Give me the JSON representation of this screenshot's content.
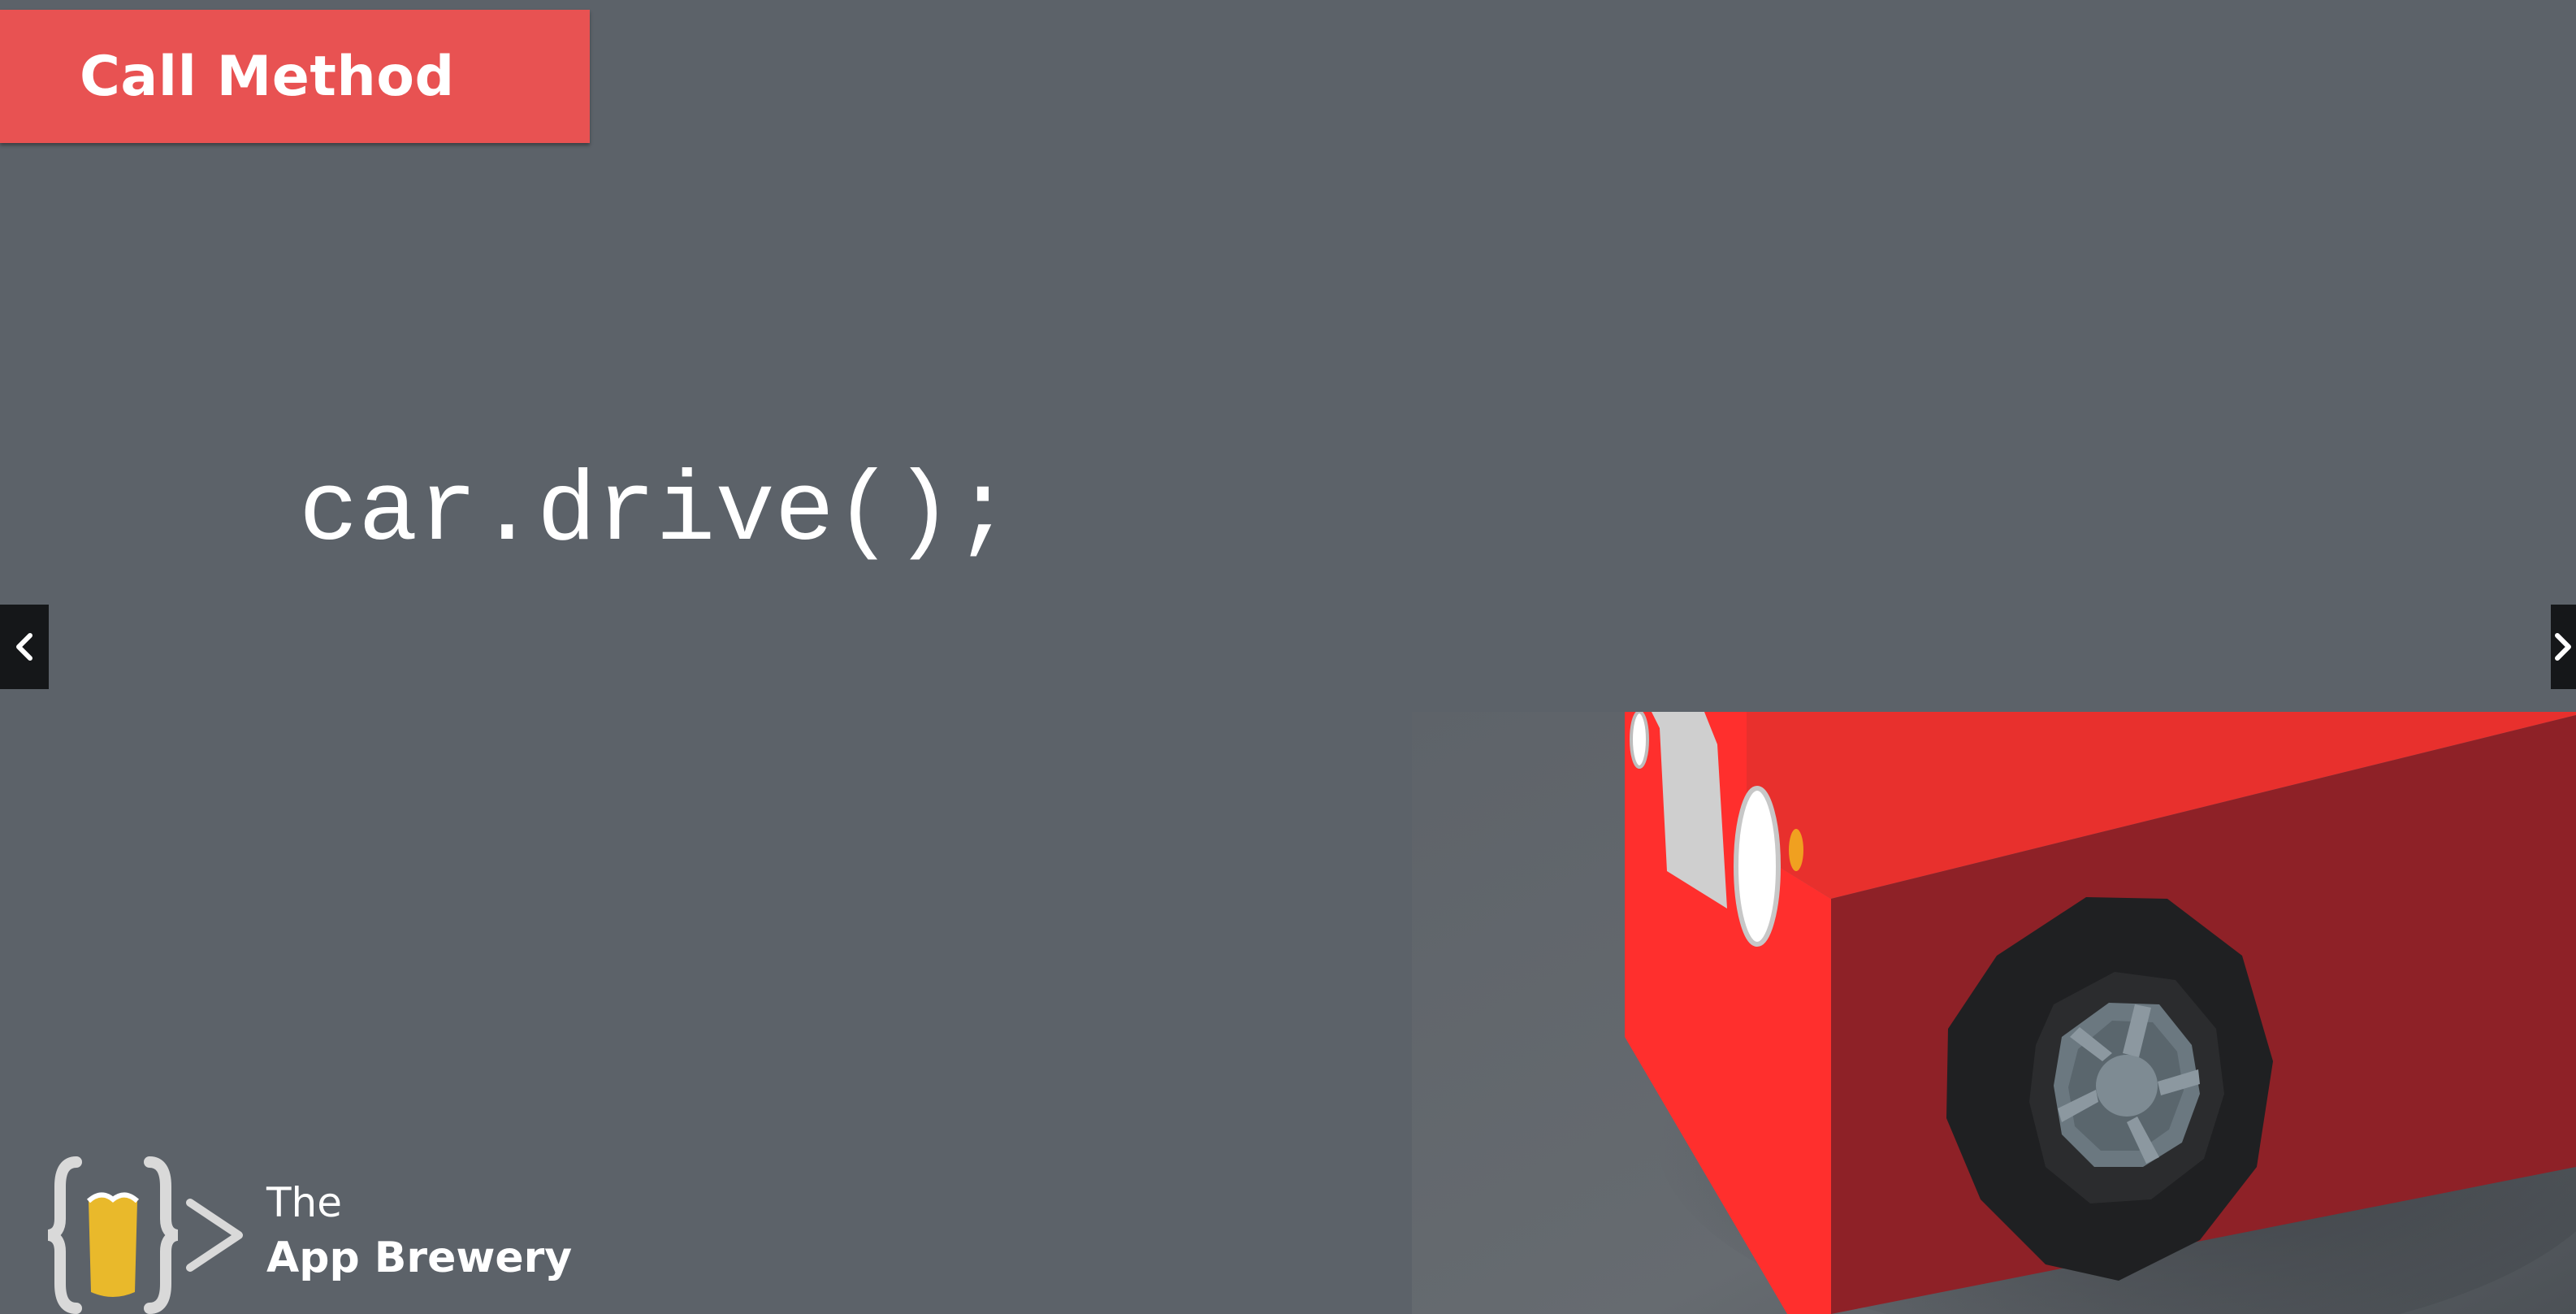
{
  "slide": {
    "title": "Call Method",
    "code": "car.drive();"
  },
  "navigation": {
    "prev_icon": "chevron-left-icon",
    "next_icon": "chevron-right-icon"
  },
  "branding": {
    "line1": "The",
    "line2": "App Brewery",
    "logo_icon": "curly-braces-beer-logo-icon"
  },
  "colors": {
    "background": "#5c6269",
    "title_banner": "#e85252",
    "car_body": "#e8302d",
    "logo_accent": "#e9b92b",
    "text": "#ffffff"
  }
}
